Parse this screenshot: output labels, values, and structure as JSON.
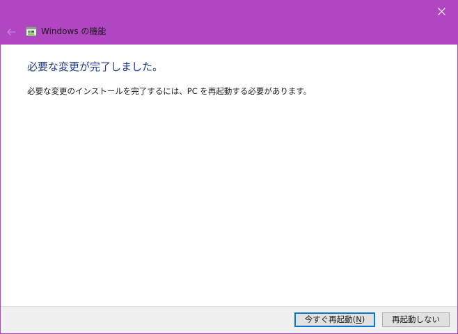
{
  "window": {
    "title": "Windows の機能",
    "accent_color": "#b146c2",
    "close_icon": "close-icon",
    "back_icon": "back-arrow-icon",
    "app_icon": "windows-features-icon"
  },
  "content": {
    "heading": "必要な変更が完了しました。",
    "heading_color": "#1f3a8a",
    "message": "必要な変更のインストールを完了するには、PC を再起動する必要があります。"
  },
  "buttons": {
    "restart_now_prefix": "今すぐ再起動(",
    "restart_now_accel": "N",
    "restart_now_suffix": ")",
    "dont_restart": "再起動しない"
  }
}
